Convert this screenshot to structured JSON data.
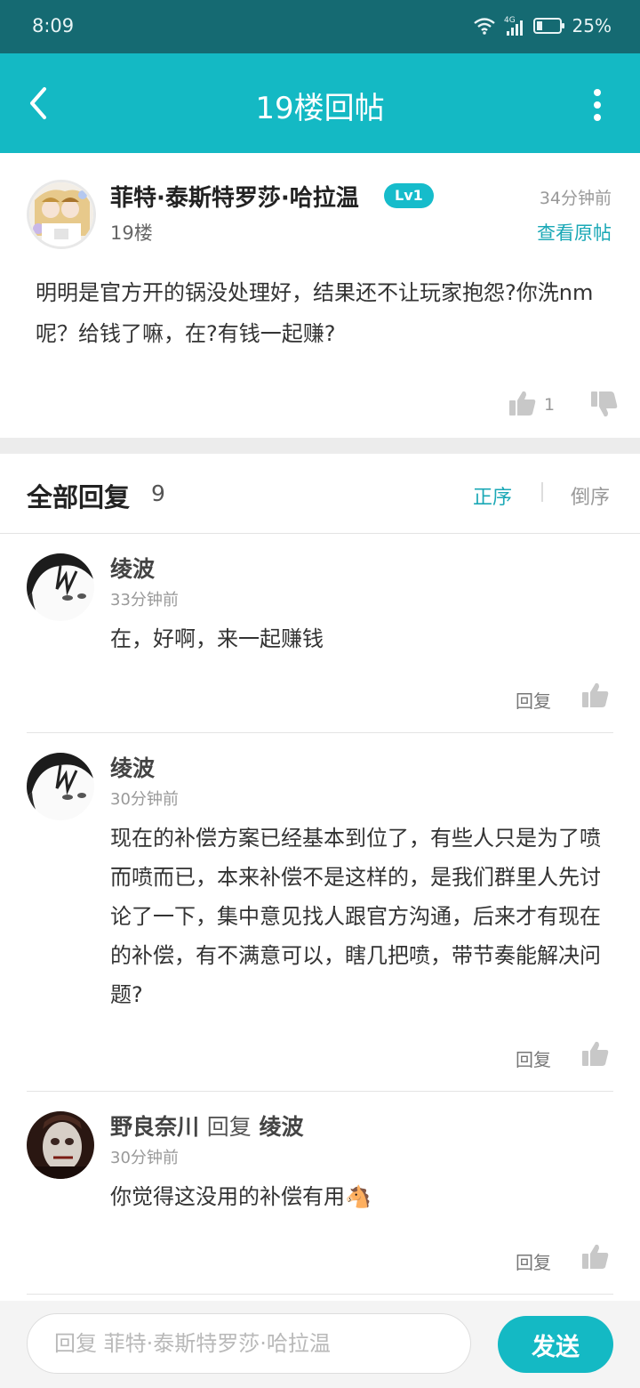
{
  "status_bar": {
    "time": "8:09",
    "network": "4G",
    "battery": "25%",
    "battery_level": 0.25,
    "icons": [
      "wifi-icon",
      "signal-icon",
      "battery-icon"
    ]
  },
  "header": {
    "title": "19楼回帖",
    "back_icon": "back-arrow-icon",
    "more_icon": "more-vertical-icon"
  },
  "post": {
    "author": "菲特·泰斯特罗莎·哈拉温",
    "level": "Lv1",
    "time": "34分钟前",
    "floor": "19楼",
    "view_original": "查看原帖",
    "content": "明明是官方开的锅没处理好，结果还不让玩家抱怨?你洗nm呢？给钱了嘛，在?有钱一起赚?",
    "like_count": "1"
  },
  "replies_section": {
    "title": "全部回复",
    "count": "9",
    "sort_asc": "正序",
    "sort_desc": "倒序"
  },
  "replies": [
    {
      "author": "绫波",
      "time": "33分钟前",
      "text": "在，好啊，来一起赚钱",
      "reply_label": "回复"
    },
    {
      "author": "绫波",
      "time": "30分钟前",
      "text": "现在的补偿方案已经基本到位了，有些人只是为了喷而喷而已，本来补偿不是这样的，是我们群里人先讨论了一下，集中意见找人跟官方沟通，后来才有现在的补偿，有不满意可以，瞎几把喷，带节奏能解决问题?",
      "reply_label": "回复"
    },
    {
      "author": "野良奈川",
      "reply_word": "回复",
      "reply_to": "绫波",
      "time": "30分钟前",
      "text": "你觉得这没用的补偿有用🐴",
      "reply_label": "回复"
    }
  ],
  "composer": {
    "placeholder": "回复 菲特·泰斯特罗莎·哈拉温",
    "value": "",
    "send_label": "发送"
  },
  "colors": {
    "status_bar": "#156a72",
    "header": "#14b9c4",
    "accent": "#1aa8b6",
    "level_badge": "#16bccb"
  }
}
